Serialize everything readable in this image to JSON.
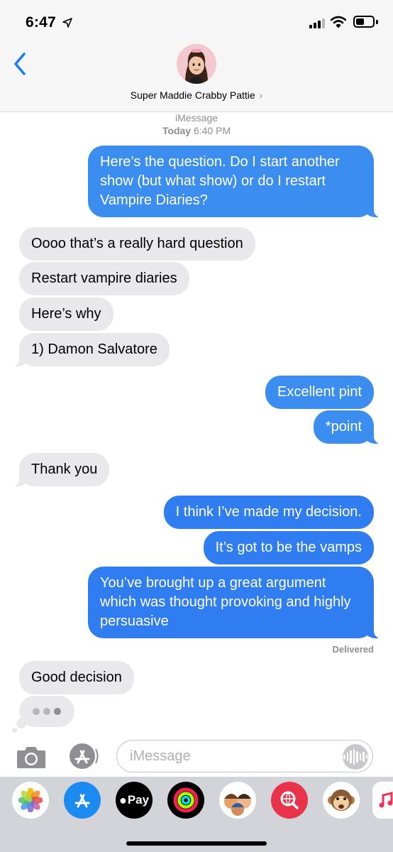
{
  "status_bar": {
    "time": "6:47"
  },
  "header": {
    "contact_name": "Super Maddie Crabby Pattie",
    "chevron": "›"
  },
  "conversation": {
    "service_label": "iMessage",
    "day_label": "Today",
    "time_label": "6:40 PM",
    "messages": [
      {
        "from": "me",
        "text": "Here’s the question. Do I start another show (but what show) or do I restart Vampire Diaries?"
      },
      {
        "from": "them",
        "text": "Oooo that’s a really hard question"
      },
      {
        "from": "them",
        "text": "Restart vampire diaries"
      },
      {
        "from": "them",
        "text": "Here’s why"
      },
      {
        "from": "them",
        "text": "1) Damon Salvatore"
      },
      {
        "from": "me",
        "text": "Excellent pint"
      },
      {
        "from": "me",
        "text": "*point"
      },
      {
        "from": "them",
        "text": "Thank you"
      },
      {
        "from": "me",
        "text": "I think I’ve made my decision."
      },
      {
        "from": "me",
        "text": "It’s got to be the vamps"
      },
      {
        "from": "me",
        "text": "You’ve brought up a great argument which was thought provoking and highly persuasive"
      },
      {
        "from": "them",
        "text": "Good decision"
      }
    ],
    "delivered_label": "Delivered"
  },
  "input": {
    "placeholder": "iMessage"
  },
  "app_drawer": {
    "apps": [
      {
        "name": "photos-app-icon"
      },
      {
        "name": "app-store-app-icon"
      },
      {
        "name": "apple-pay-app-icon",
        "label": "Pay"
      },
      {
        "name": "activity-app-icon"
      },
      {
        "name": "memoji-stickers-app-icon"
      },
      {
        "name": "web-search-app-icon"
      },
      {
        "name": "animoji-app-icon"
      },
      {
        "name": "music-app-icon"
      }
    ]
  },
  "colors": {
    "outgoing_bubble": "#3b8ef0",
    "incoming_bubble": "#e9e9eb",
    "accent": "#1a7cf5"
  }
}
